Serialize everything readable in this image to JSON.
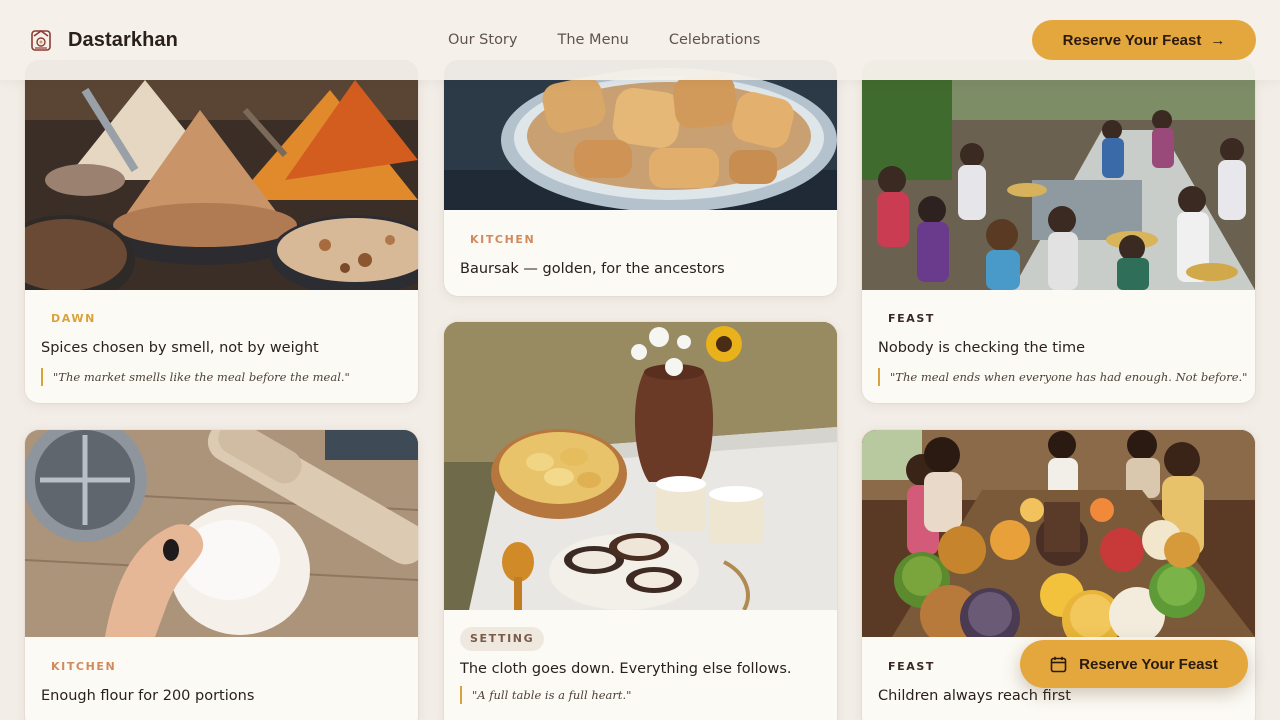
{
  "header": {
    "brand": "Dastarkhan",
    "nav": [
      "Our Story",
      "The Menu",
      "Celebrations"
    ],
    "cta": "Reserve Your Feast",
    "cta_icon": "arrow-right-icon"
  },
  "cards": [
    {
      "tag": "DAWN",
      "title": "Spices chosen by smell, not by weight",
      "quote": "\"The market smells like the meal before the meal.\"",
      "image": "spice-market-photo"
    },
    {
      "tag": "KITCHEN",
      "title": "Baursak — golden, for the ancestors",
      "image": "baursak-bowl-photo"
    },
    {
      "tag": "FEAST",
      "title": "Nobody is checking the time",
      "quote": "\"The meal ends when everyone has had enough. Not before.\"",
      "image": "outdoor-gathering-photo"
    },
    {
      "tag": "KITCHEN",
      "title": "Enough flour for 200 portions",
      "image": "dough-rolling-photo"
    },
    {
      "tag": "SETTING",
      "title": "The cloth goes down. Everything else follows.",
      "quote": "\"A full table is a full heart.\"",
      "image": "table-setting-photo"
    },
    {
      "tag": "FEAST",
      "title": "Children always reach first",
      "image": "family-feast-photo"
    }
  ],
  "floating_cta": {
    "label": "Reserve Your Feast",
    "icon": "calendar-icon"
  },
  "colors": {
    "accent": "#e3a73d",
    "background": "#f3ede7",
    "card": "#fcfaf5",
    "tag_kitchen": "#d08a5e",
    "tag_dawn": "#d9a23b"
  }
}
